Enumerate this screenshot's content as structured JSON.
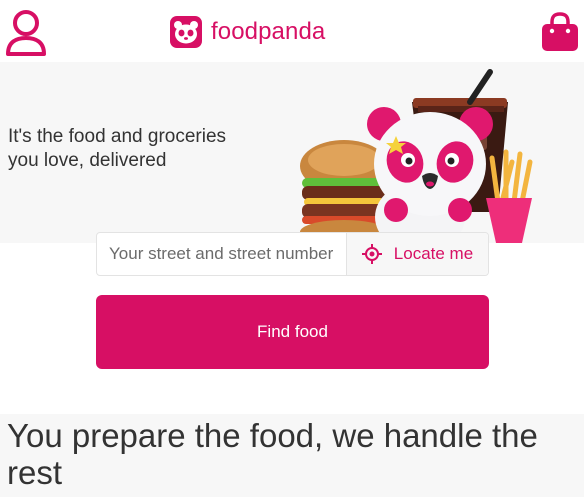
{
  "header": {
    "logo_text": "foodpanda",
    "user_icon": "user-icon",
    "bag_icon": "shopping-bag-icon",
    "brand_color": "#d70f64"
  },
  "hero": {
    "tagline_line1": "It's the food and groceries",
    "tagline_line2": "you love, delivered",
    "illustration": "panda-mascot-with-food"
  },
  "search": {
    "placeholder": "Your street and street number",
    "locate_label": "Locate me",
    "locate_icon": "crosshair-icon"
  },
  "cta": {
    "find_label": "Find food"
  },
  "section": {
    "title": "You prepare the food, we handle the rest"
  }
}
